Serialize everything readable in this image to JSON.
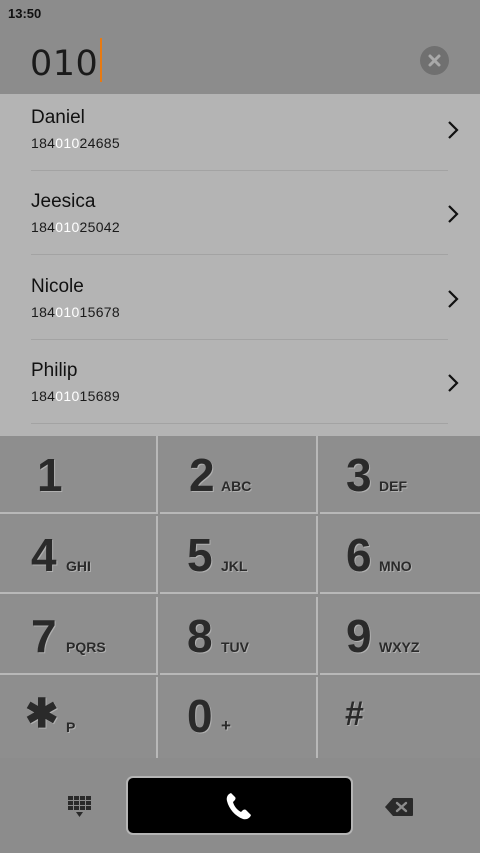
{
  "status_bar": {
    "time": "13:50"
  },
  "dialer": {
    "input_value": "010"
  },
  "contacts": [
    {
      "name": "Daniel",
      "number_pre": "184",
      "number_match": "010",
      "number_post": "24685"
    },
    {
      "name": "Jeesica",
      "number_pre": "184",
      "number_match": "010",
      "number_post": "25042"
    },
    {
      "name": "Nicole",
      "number_pre": "184",
      "number_match": "010",
      "number_post": "15678"
    },
    {
      "name": "Philip",
      "number_pre": "184",
      "number_match": "010",
      "number_post": "15689"
    }
  ],
  "keypad": {
    "keys": [
      {
        "digit": "1",
        "letters": ""
      },
      {
        "digit": "2",
        "letters": "ABC"
      },
      {
        "digit": "3",
        "letters": "DEF"
      },
      {
        "digit": "4",
        "letters": "GHI"
      },
      {
        "digit": "5",
        "letters": "JKL"
      },
      {
        "digit": "6",
        "letters": "MNO"
      },
      {
        "digit": "7",
        "letters": "PQRS"
      },
      {
        "digit": "8",
        "letters": "TUV"
      },
      {
        "digit": "9",
        "letters": "WXYZ"
      },
      {
        "digit": "✱",
        "letters": "P"
      },
      {
        "digit": "0",
        "letters": "+"
      },
      {
        "digit": "#",
        "letters": ""
      }
    ]
  },
  "icons": {
    "clear": "clear-circle-icon",
    "chevron": "chevron-right-icon",
    "dialpad": "dialpad-grid-icon",
    "call": "phone-handset-icon",
    "backspace": "backspace-icon"
  },
  "colors": {
    "caret": "#e87a12",
    "match_highlight": "#ffffff",
    "call_button": "#000000"
  }
}
